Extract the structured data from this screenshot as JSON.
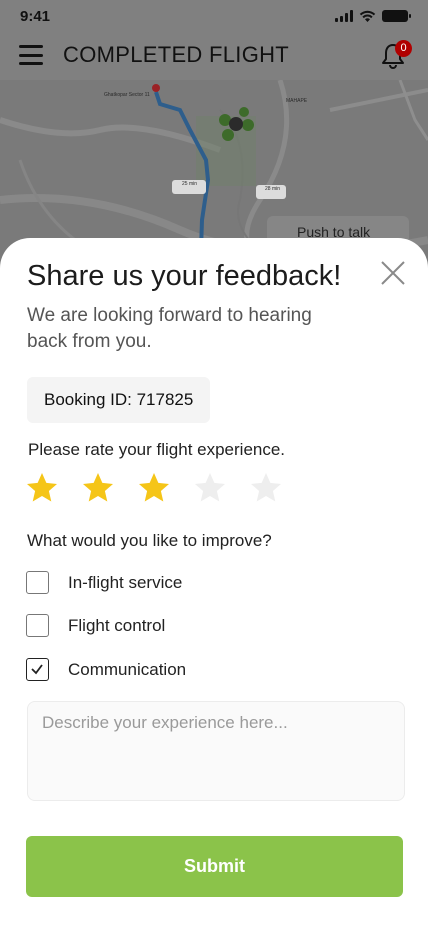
{
  "status_bar": {
    "time": "9:41"
  },
  "header": {
    "title": "COMPLETED FLIGHT",
    "notification_count": "0"
  },
  "map": {
    "labels": [
      "Ghatkopar Sector 11",
      "MAHAPE",
      "25 min",
      "28 min"
    ],
    "push_to_talk": "Push to talk"
  },
  "feedback": {
    "title": "Share us your feedback!",
    "subtitle": "We are looking forward to hearing back from you.",
    "booking_id": "Booking ID: 717825",
    "rate_label": "Please rate your flight experience.",
    "rating": {
      "value": 3,
      "max": 5
    },
    "improve_label": "What would you like to improve?",
    "options": [
      {
        "label": "In-flight service",
        "checked": false
      },
      {
        "label": "Flight control",
        "checked": false
      },
      {
        "label": "Communication",
        "checked": true
      }
    ],
    "textarea_placeholder": "Describe your experience here...",
    "submit_label": "Submit"
  },
  "colors": {
    "overlay": "#808080",
    "star_filled": "#f5c518",
    "star_empty": "#eeeeee",
    "submit": "#8bc34a",
    "badge": "#b00000"
  },
  "icons": [
    "menu-icon",
    "bell-icon",
    "close-icon",
    "star-icon",
    "check-icon",
    "signal-icon",
    "wifi-icon",
    "battery-icon"
  ]
}
